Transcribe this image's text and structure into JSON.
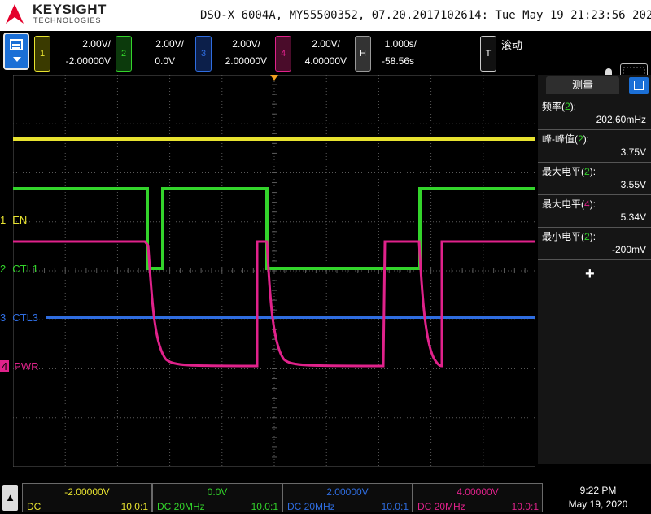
{
  "brand": {
    "name": "KEYSIGHT",
    "sub": "TECHNOLOGIES"
  },
  "header": {
    "info": "DSO-X 6004A, MY55500352, 07.20.2017102614: Tue May 19 21:23:56 2020"
  },
  "channels": [
    {
      "num": "1",
      "scale": "2.00V/",
      "offset": "-2.00000V",
      "color": "#e8e330"
    },
    {
      "num": "2",
      "scale": "2.00V/",
      "offset": "0.0V",
      "color": "#33d42b"
    },
    {
      "num": "3",
      "scale": "2.00V/",
      "offset": "2.00000V",
      "color": "#2f6de0"
    },
    {
      "num": "4",
      "scale": "2.00V/",
      "offset": "4.00000V",
      "color": "#e0228b"
    }
  ],
  "timebase": {
    "label": "H",
    "scale": "1.000s/",
    "delay": "-58.56s"
  },
  "trigger": {
    "label": "T",
    "mode": "滚动"
  },
  "traces": [
    {
      "marker": "1",
      "name": "EN"
    },
    {
      "marker": "2",
      "name": "CTL1"
    },
    {
      "marker": "3",
      "name": "CTL3"
    },
    {
      "marker": "4",
      "name": "PWR"
    }
  ],
  "panel": {
    "title": "测量",
    "measurements": [
      {
        "name": "频率",
        "ch": "2",
        "value": "202.60mHz",
        "color": "#33d42b"
      },
      {
        "name": "峰-峰值",
        "ch": "2",
        "value": "3.75V",
        "color": "#33d42b"
      },
      {
        "name": "最大电平",
        "ch": "2",
        "value": "3.55V",
        "color": "#33d42b"
      },
      {
        "name": "最大电平",
        "ch": "4",
        "value": "5.34V",
        "color": "#e0228b"
      },
      {
        "name": "最小电平",
        "ch": "2",
        "value": "-200mV",
        "color": "#33d42b"
      }
    ],
    "add": "+"
  },
  "bottom": [
    {
      "offset": "-2.00000V",
      "coupling": "DC",
      "probe": "10.0:1",
      "color": "#e8e330"
    },
    {
      "offset": "0.0V",
      "coupling": "DC 20MHz",
      "probe": "10.0:1",
      "color": "#33d42b"
    },
    {
      "offset": "2.00000V",
      "coupling": "DC 20MHz",
      "probe": "10.0:1",
      "color": "#2f6de0"
    },
    {
      "offset": "4.00000V",
      "coupling": "DC 20MHz",
      "probe": "10.0:1",
      "color": "#e0228b"
    }
  ],
  "clock": {
    "time": "9:22 PM",
    "date": "May 19, 2020"
  }
}
